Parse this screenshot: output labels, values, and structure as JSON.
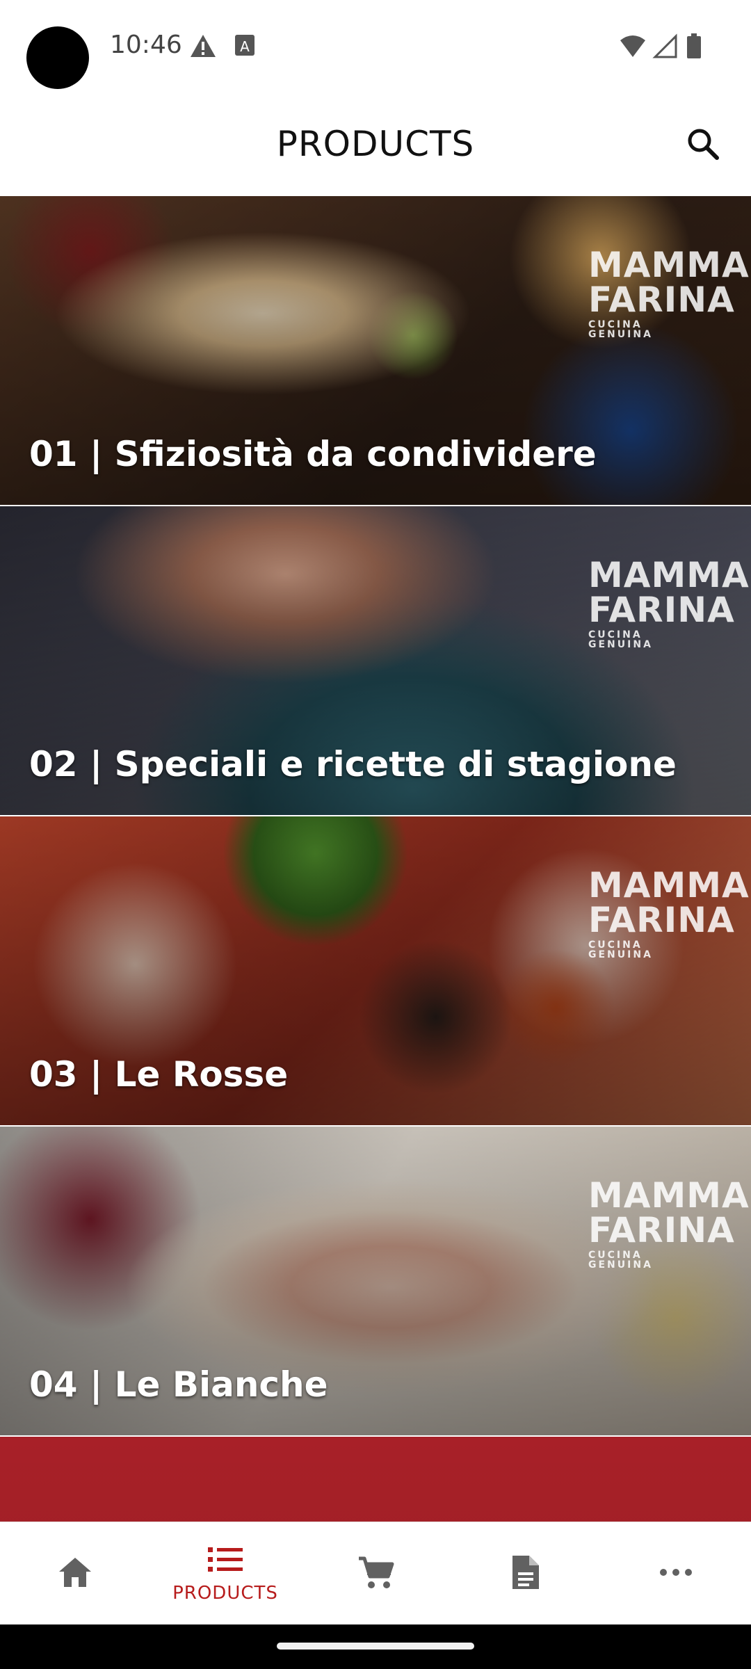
{
  "status_bar": {
    "time": "10:46",
    "icons": [
      "warning-icon",
      "a-box-icon",
      "wifi-icon",
      "signal-icon",
      "battery-icon"
    ]
  },
  "app_bar": {
    "title": "PRODUCTS",
    "search_icon": "search-icon"
  },
  "categories": [
    {
      "label": "01 | Sfiziosità da condividere",
      "watermark": [
        "MAMMA",
        "FARINA",
        "CUCINA GENUINA"
      ]
    },
    {
      "label": "02 | Speciali e ricette di stagione",
      "watermark": [
        "MAMMA",
        "FARINA",
        "CUCINA GENUINA"
      ]
    },
    {
      "label": "03 | Le Rosse",
      "watermark": [
        "MAMMA",
        "FARINA",
        "CUCINA GENUINA"
      ]
    },
    {
      "label": "04 | Le Bianche",
      "watermark": [
        "MAMMA",
        "FARINA",
        "CUCINA GENUINA"
      ]
    }
  ],
  "bottom_nav": {
    "items": [
      {
        "icon": "home-icon",
        "label": ""
      },
      {
        "icon": "list-icon",
        "label": "PRODUCTS",
        "active": true
      },
      {
        "icon": "cart-icon",
        "label": ""
      },
      {
        "icon": "document-icon",
        "label": ""
      },
      {
        "icon": "more-icon",
        "label": ""
      }
    ],
    "active_color": "#b71c1c",
    "inactive_color": "#616161"
  }
}
